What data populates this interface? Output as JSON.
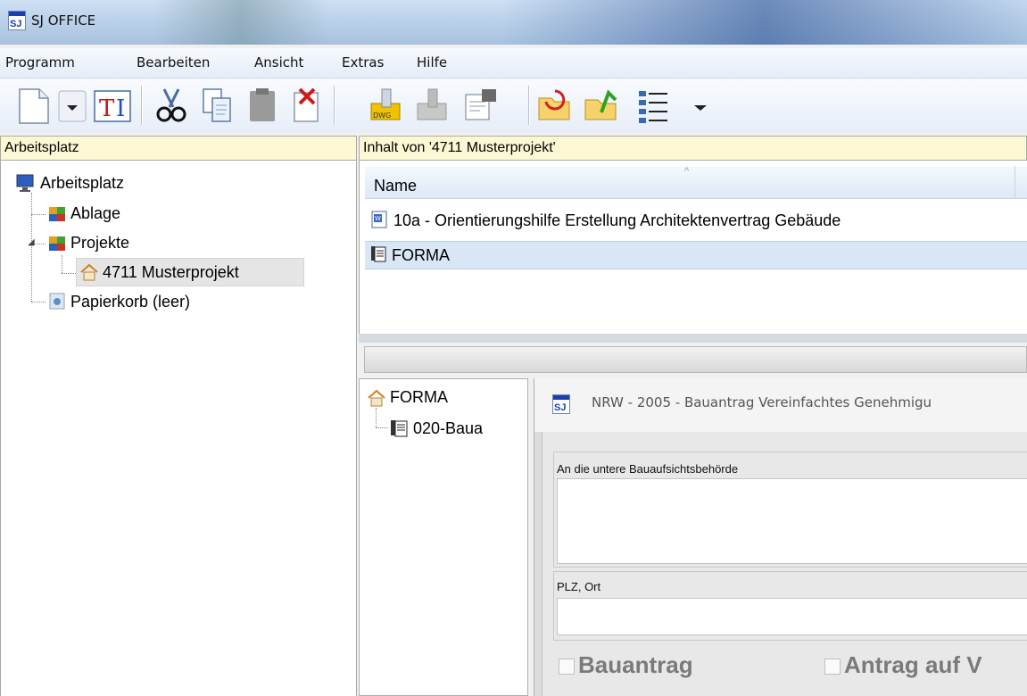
{
  "window": {
    "title": "SJ OFFICE",
    "logo_text": "SJ"
  },
  "menu": [
    {
      "label": "Programm"
    },
    {
      "label": "Bearbeiten"
    },
    {
      "label": "Ansicht"
    },
    {
      "label": "Extras"
    },
    {
      "label": "Hilfe"
    }
  ],
  "toolbar": {
    "buttons": [
      "new-document",
      "dropdown",
      "text-insert",
      "cut",
      "copy",
      "paste",
      "delete",
      "dwg-import",
      "dwg-export",
      "properties",
      "folder-open",
      "folder-up",
      "view-details",
      "view-dropdown"
    ]
  },
  "left_pane": {
    "header": "Arbeitsplatz",
    "tree": [
      {
        "label": "Arbeitsplatz"
      },
      {
        "label": "Ablage"
      },
      {
        "label": "Projekte"
      },
      {
        "label": "4711 Musterprojekt"
      },
      {
        "label": "Papierkorb (leer)"
      }
    ]
  },
  "content": {
    "header": "Inhalt von '4711 Musterprojekt'",
    "column_name": "Name",
    "rows": [
      {
        "label": "10a - Orientierungshilfe Erstellung Architektenvertrag Gebäude"
      },
      {
        "label": "FORMA"
      }
    ]
  },
  "lower_tree": [
    {
      "label": "FORMA"
    },
    {
      "label": "020-Baua"
    }
  ],
  "form": {
    "logo_text": "SJ",
    "title": "NRW - 2005 - Bauantrag Vereinfachtes Genehmigu",
    "fields": [
      {
        "label": "An die untere Bauaufsichtsbehörde",
        "value": ""
      },
      {
        "label": "PLZ, Ort",
        "value": ""
      }
    ],
    "checkboxes": [
      {
        "label": "Bauantrag",
        "checked": false
      },
      {
        "label": "Antrag auf V",
        "checked": false
      }
    ]
  }
}
